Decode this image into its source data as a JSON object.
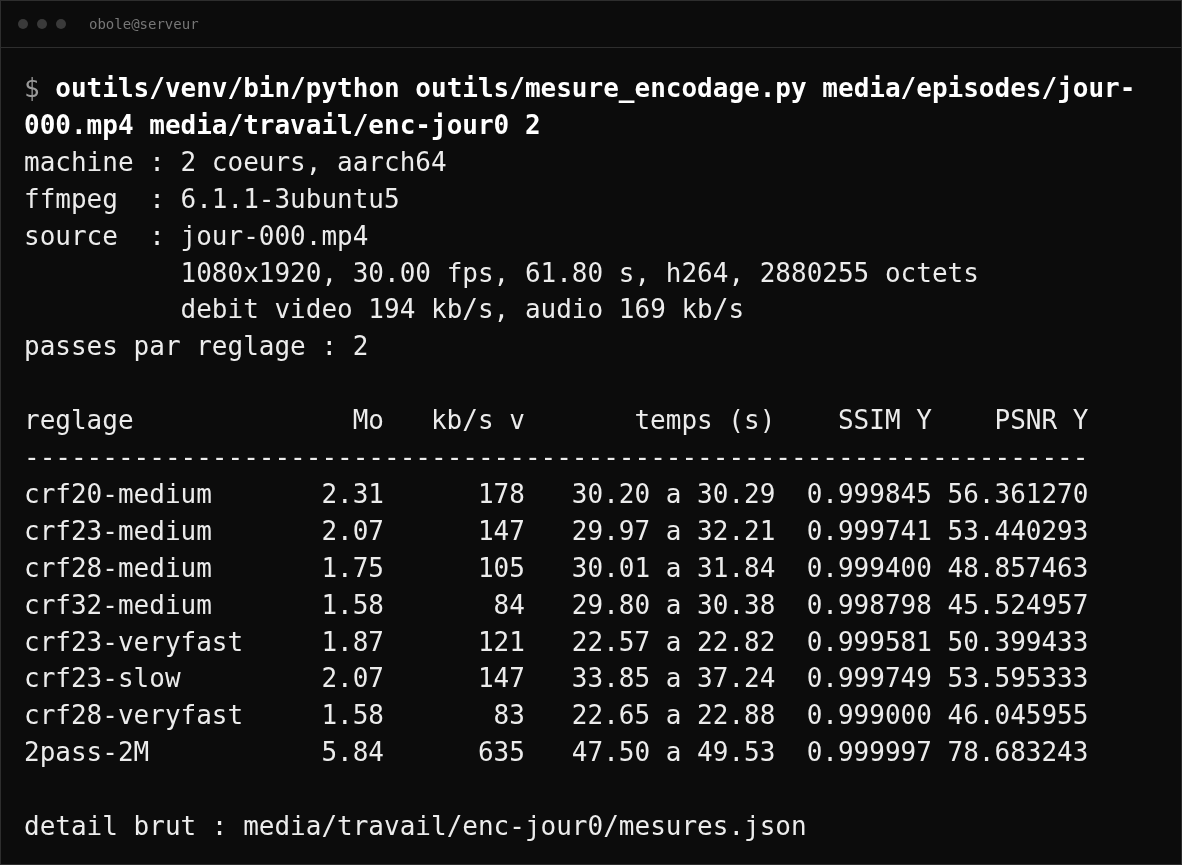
{
  "window": {
    "title": "obole@serveur"
  },
  "terminal": {
    "prompt": "$",
    "command": "outils/venv/bin/python outils/mesure_encodage.py media/episodes/jour-000.mp4 media/travail/enc-jour0 2",
    "lines": [
      {
        "kind": "line",
        "text": "machine : 2 coeurs, aarch64"
      },
      {
        "kind": "line",
        "text": "ffmpeg  : 6.1.1-3ubuntu5"
      },
      {
        "kind": "line",
        "text": "source  : jour-000.mp4"
      },
      {
        "kind": "continuation",
        "text": "1080x1920, 30.00 fps, 61.80 s, h264, 2880255 octets"
      },
      {
        "kind": "continuation",
        "text": "debit video 194 kb/s, audio 169 kb/s"
      },
      {
        "kind": "line",
        "text": "passes par reglage : 2"
      }
    ],
    "table": {
      "columns": [
        "reglage",
        "Mo",
        "kb/s v",
        "temps (s)",
        "SSIM Y",
        "PSNR Y"
      ],
      "rule": "--------------------------------------------------------------------",
      "rows": [
        [
          "crf20-medium",
          "2.31",
          "178",
          "30.20 a 30.29",
          "0.999845",
          "56.361270"
        ],
        [
          "crf23-medium",
          "2.07",
          "147",
          "29.97 a 32.21",
          "0.999741",
          "53.440293"
        ],
        [
          "crf28-medium",
          "1.75",
          "105",
          "30.01 a 31.84",
          "0.999400",
          "48.857463"
        ],
        [
          "crf32-medium",
          "1.58",
          "84",
          "29.80 a 30.38",
          "0.998798",
          "45.524957"
        ],
        [
          "crf23-veryfast",
          "1.87",
          "121",
          "22.57 a 22.82",
          "0.999581",
          "50.399433"
        ],
        [
          "crf23-slow",
          "2.07",
          "147",
          "33.85 a 37.24",
          "0.999749",
          "53.595333"
        ],
        [
          "crf28-veryfast",
          "1.58",
          "83",
          "22.65 a 22.88",
          "0.999000",
          "46.045955"
        ],
        [
          "2pass-2M",
          "5.84",
          "635",
          "47.50 a 49.53",
          "0.999997",
          "78.683243"
        ]
      ]
    },
    "footer": "detail brut : media/travail/enc-jour0/mesures.json"
  }
}
